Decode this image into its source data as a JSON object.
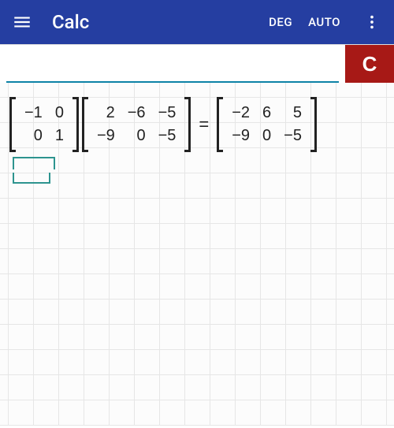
{
  "appbar": {
    "title": "Calc",
    "angle_mode": "DEG",
    "precision_mode": "AUTO"
  },
  "input": {
    "value": "",
    "placeholder": "",
    "clear_label": "C"
  },
  "expression": {
    "m1": [
      [
        "−1",
        "0"
      ],
      [
        "0",
        "1"
      ]
    ],
    "m2": [
      [
        "2",
        "−6",
        "−5"
      ],
      [
        "−9",
        "0",
        "−5"
      ]
    ],
    "result": [
      [
        "−2",
        "6",
        "5"
      ],
      [
        "−9",
        "0",
        "−5"
      ]
    ],
    "equals": "="
  }
}
